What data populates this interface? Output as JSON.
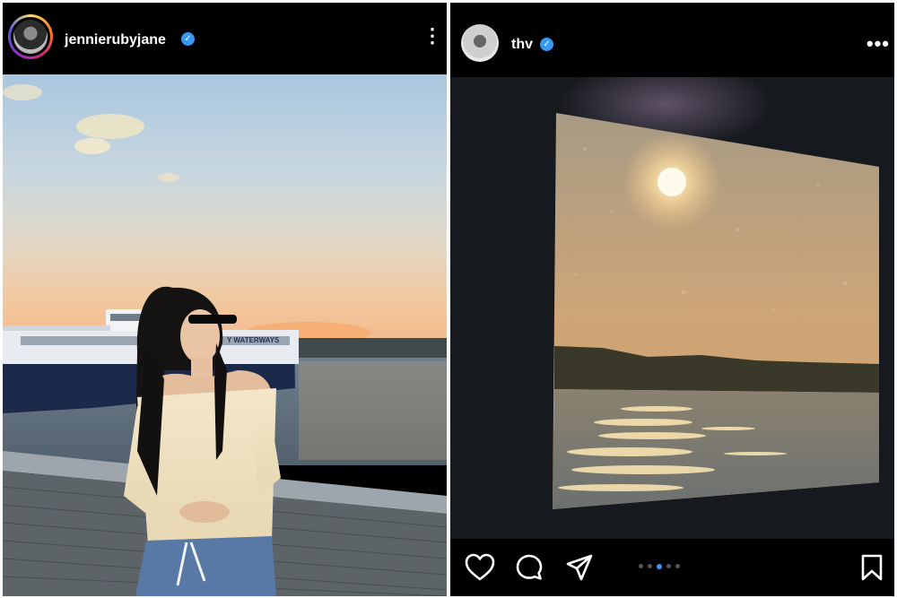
{
  "posts": [
    {
      "username": "jennierubyjane",
      "verified": true,
      "avatar_icon": "avatar-story-ring",
      "photo_sign_text": "Y WATERWAYS"
    },
    {
      "username": "thv",
      "verified": true,
      "avatar_icon": "avatar",
      "carousel": {
        "total": 5,
        "active": 3
      }
    }
  ],
  "icons": {
    "verified": "verified-badge-icon",
    "more": "more-options-icon",
    "like": "heart-icon",
    "comment": "comment-icon",
    "share": "send-icon",
    "save": "bookmark-icon"
  },
  "colors": {
    "verified": "#3897f0",
    "background": "#000000"
  }
}
